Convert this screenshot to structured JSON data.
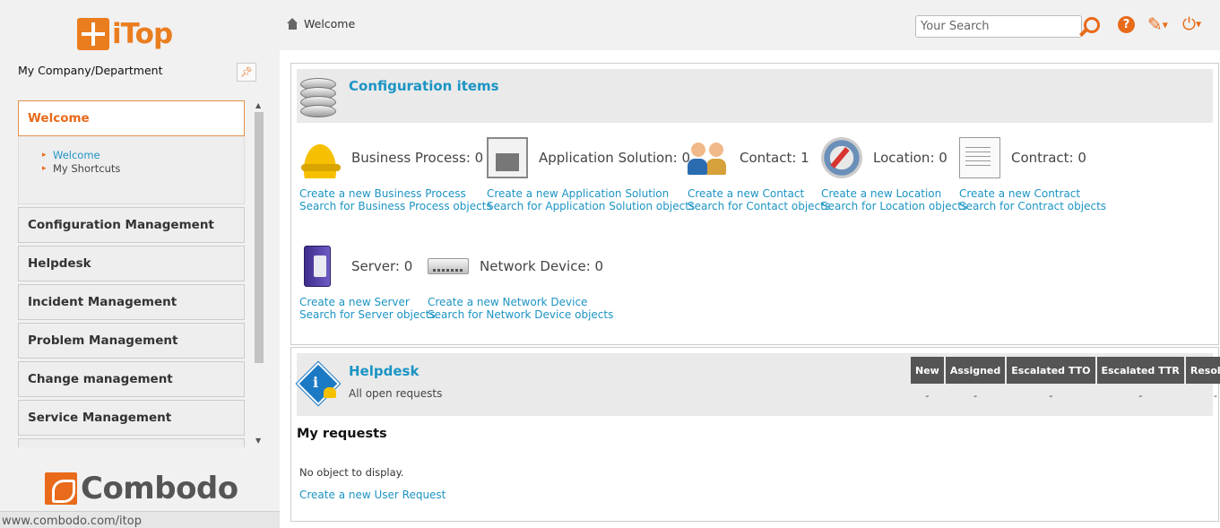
{
  "branding": {
    "app_name": "iTop",
    "vendor": "Combodo",
    "accent": "#e86a1a",
    "link_color": "#1c94c4"
  },
  "sidebar": {
    "org_label": "My Company/Department",
    "pin_icon": "pin-icon",
    "menus": [
      {
        "label": "Welcome",
        "active": true,
        "items": [
          {
            "label": "Welcome"
          },
          {
            "label": "My Shortcuts"
          }
        ]
      },
      {
        "label": "Configuration Management"
      },
      {
        "label": "Helpdesk"
      },
      {
        "label": "Incident Management"
      },
      {
        "label": "Problem Management"
      },
      {
        "label": "Change management"
      },
      {
        "label": "Service Management"
      }
    ]
  },
  "status_bar": {
    "url": "www.combodo.com/itop"
  },
  "topbar": {
    "breadcrumb": "Welcome",
    "search_placeholder": "Your Search",
    "icons": [
      "home-icon",
      "search-icon",
      "help-icon",
      "edit-icon",
      "power-icon"
    ]
  },
  "ci_dashlet": {
    "title": "Configuration items",
    "items": [
      {
        "label": "Business Process: 0",
        "create": "Create a new Business Process",
        "search": "Search for Business Process objects"
      },
      {
        "label": "Application Solution: 0",
        "create": "Create a new Application Solution",
        "search": "Search for Application Solution objects"
      },
      {
        "label": "Contact: 1",
        "create": "Create a new Contact",
        "search": "Search for Contact objects"
      },
      {
        "label": "Location: 0",
        "create": "Create a new Location",
        "search": "Search for Location objects"
      },
      {
        "label": "Contract: 0",
        "create": "Create a new Contract",
        "search": "Search for Contract objects"
      },
      {
        "label": "Server: 0",
        "create": "Create a new Server",
        "search": "Search for Server objects"
      },
      {
        "label": "Network Device: 0",
        "create": "Create a new Network Device",
        "search": "Search for Network Device objects"
      }
    ]
  },
  "helpdesk_dashlet": {
    "title": "Helpdesk",
    "subtitle": "All open requests",
    "columns": [
      "New",
      "Assigned",
      "Escalated TTO",
      "Escalated TTR",
      "Resolved"
    ],
    "values": [
      "-",
      "-",
      "-",
      "-",
      "-"
    ],
    "my_requests_title": "My requests",
    "empty_text": "No object to display.",
    "create_link": "Create a new User Request"
  }
}
